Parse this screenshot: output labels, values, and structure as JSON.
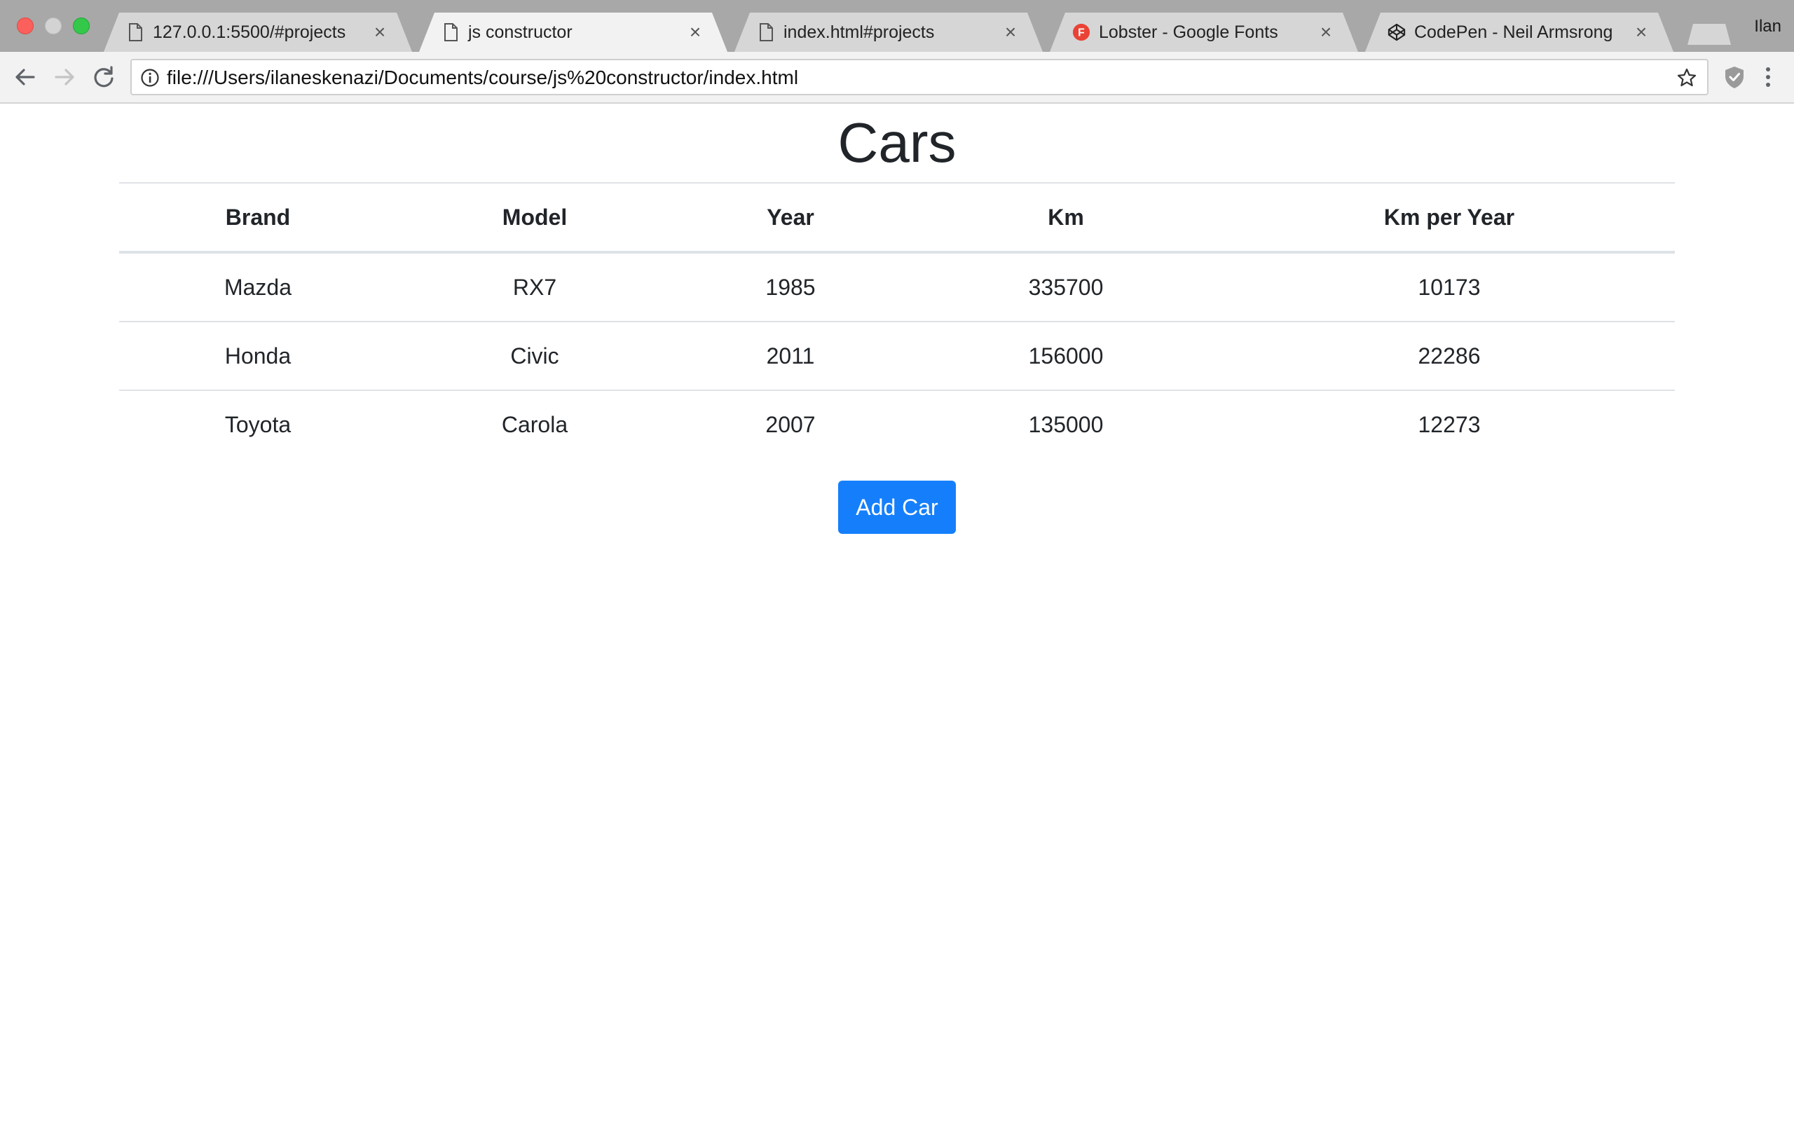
{
  "browser": {
    "tabs": [
      {
        "title": "127.0.0.1:5500/#projects",
        "icon": "document-icon",
        "active": false
      },
      {
        "title": "js constructor",
        "icon": "document-icon",
        "active": true
      },
      {
        "title": "index.html#projects",
        "icon": "document-icon",
        "active": false
      },
      {
        "title": "Lobster - Google Fonts",
        "icon": "google-fonts-icon",
        "active": false
      },
      {
        "title": "CodePen - Neil Armsrong",
        "icon": "codepen-icon",
        "active": false
      }
    ],
    "close_glyph": "×",
    "profile_name": "Ilan",
    "url": "file:///Users/ilaneskenazi/Documents/course/js%20constructor/index.html"
  },
  "page": {
    "title": "Cars",
    "table": {
      "headers": [
        "Brand",
        "Model",
        "Year",
        "Km",
        "Km per Year"
      ],
      "rows": [
        [
          "Mazda",
          "RX7",
          "1985",
          "335700",
          "10173"
        ],
        [
          "Honda",
          "Civic",
          "2011",
          "156000",
          "22286"
        ],
        [
          "Toyota",
          "Carola",
          "2007",
          "135000",
          "12273"
        ]
      ]
    },
    "add_button_label": "Add Car"
  },
  "colors": {
    "primary_button": "#157ffb",
    "text": "#212529",
    "table_border": "#dee2e6"
  }
}
